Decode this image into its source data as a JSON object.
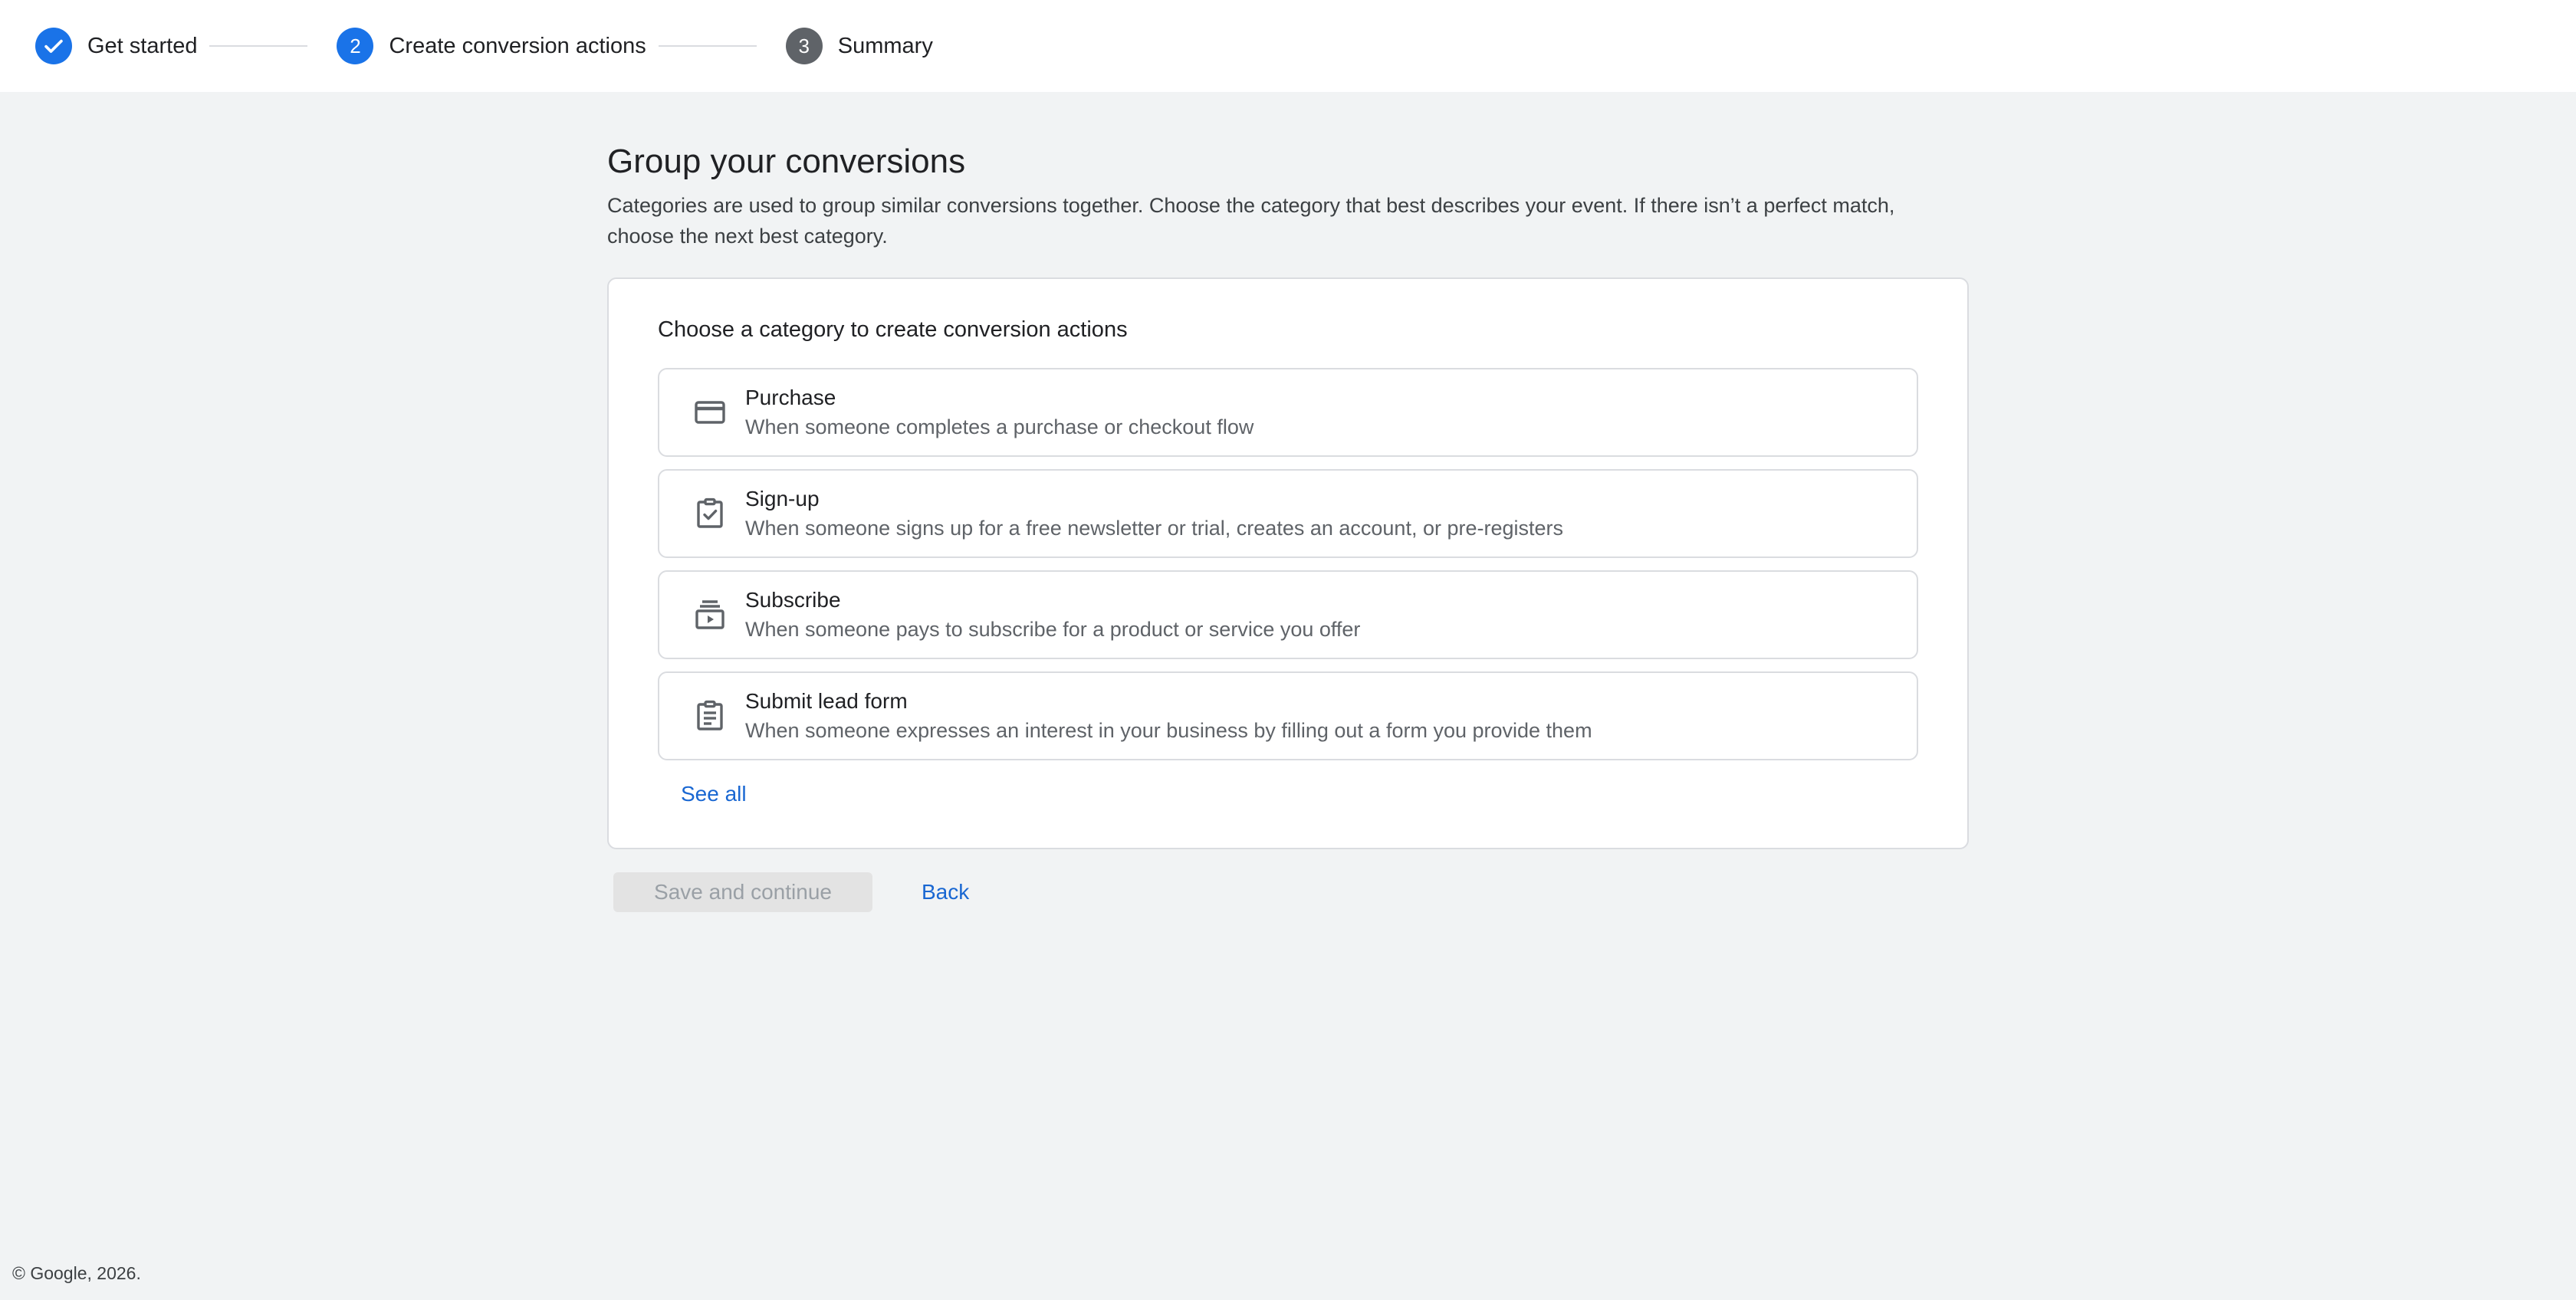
{
  "stepper": {
    "steps": [
      {
        "number": "1",
        "label": "Get started",
        "state": "done"
      },
      {
        "number": "2",
        "label": "Create conversion actions",
        "state": "active"
      },
      {
        "number": "3",
        "label": "Summary",
        "state": "pending"
      }
    ]
  },
  "main": {
    "title": "Group your conversions",
    "description": "Categories are used to group similar conversions together. Choose the category that best describes your event. If there isn’t a perfect match, choose the next best category."
  },
  "card": {
    "heading": "Choose a category to create conversion actions",
    "options": [
      {
        "icon": "credit-card-icon",
        "title": "Purchase",
        "description": "When someone completes a purchase or checkout flow"
      },
      {
        "icon": "clipboard-check-icon",
        "title": "Sign-up",
        "description": "When someone signs up for a free newsletter or trial, creates an account, or pre-registers"
      },
      {
        "icon": "subscriptions-icon",
        "title": "Subscribe",
        "description": "When someone pays to subscribe for a product or service you offer"
      },
      {
        "icon": "lead-form-icon",
        "title": "Submit lead form",
        "description": "When someone expresses an interest in your business by filling out a form you provide them"
      }
    ],
    "see_all_label": "See all"
  },
  "actions": {
    "save_label": "Save and continue",
    "back_label": "Back"
  },
  "footer": {
    "copyright": "© Google, 2026."
  },
  "colors": {
    "accent": "#1a73e8",
    "link": "#1967d2",
    "pending_step": "#5f6368",
    "page_background": "#f1f3f4",
    "disabled_button": "#e3e3e3"
  }
}
